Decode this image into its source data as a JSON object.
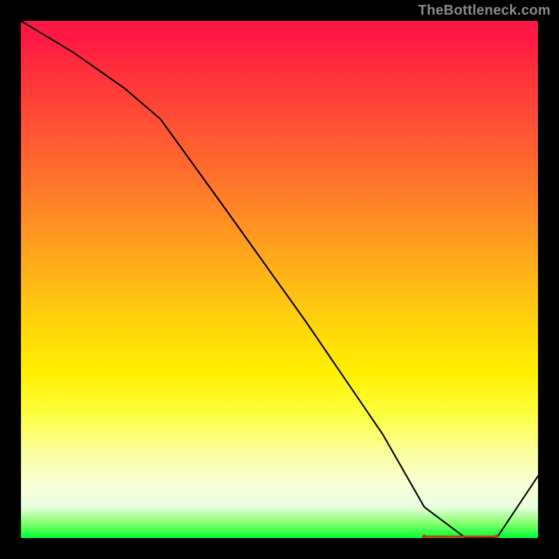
{
  "watermark": "TheBottleneck.com",
  "chart_data": {
    "type": "line",
    "title": "",
    "xlabel": "",
    "ylabel": "",
    "xlim": [
      0,
      100
    ],
    "ylim": [
      0,
      100
    ],
    "series": [
      {
        "name": "bottleneck-curve",
        "x": [
          0,
          10,
          20,
          27,
          40,
          55,
          70,
          78,
          86,
          92,
          100
        ],
        "y": [
          100,
          94,
          87,
          81,
          63,
          42,
          20,
          6,
          0,
          0,
          12
        ]
      }
    ],
    "annotations": [
      {
        "name": "optimal-flat-region",
        "x_start": 78,
        "x_end": 92,
        "y": 0
      }
    ],
    "background_gradient": {
      "top": "#ff1846",
      "mid": "#fff000",
      "bottom": "#00ff32"
    }
  }
}
